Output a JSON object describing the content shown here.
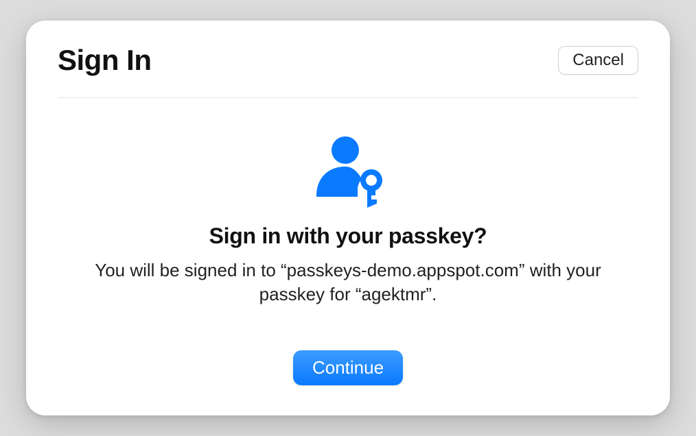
{
  "header": {
    "title": "Sign In",
    "cancel_label": "Cancel"
  },
  "prompt": {
    "title": "Sign in with your passkey?",
    "body": "You will be signed in to “passkeys-demo.appspot.com” with your passkey for “agektmr”.",
    "continue_label": "Continue"
  },
  "colors": {
    "accent": "#0a7aff"
  }
}
